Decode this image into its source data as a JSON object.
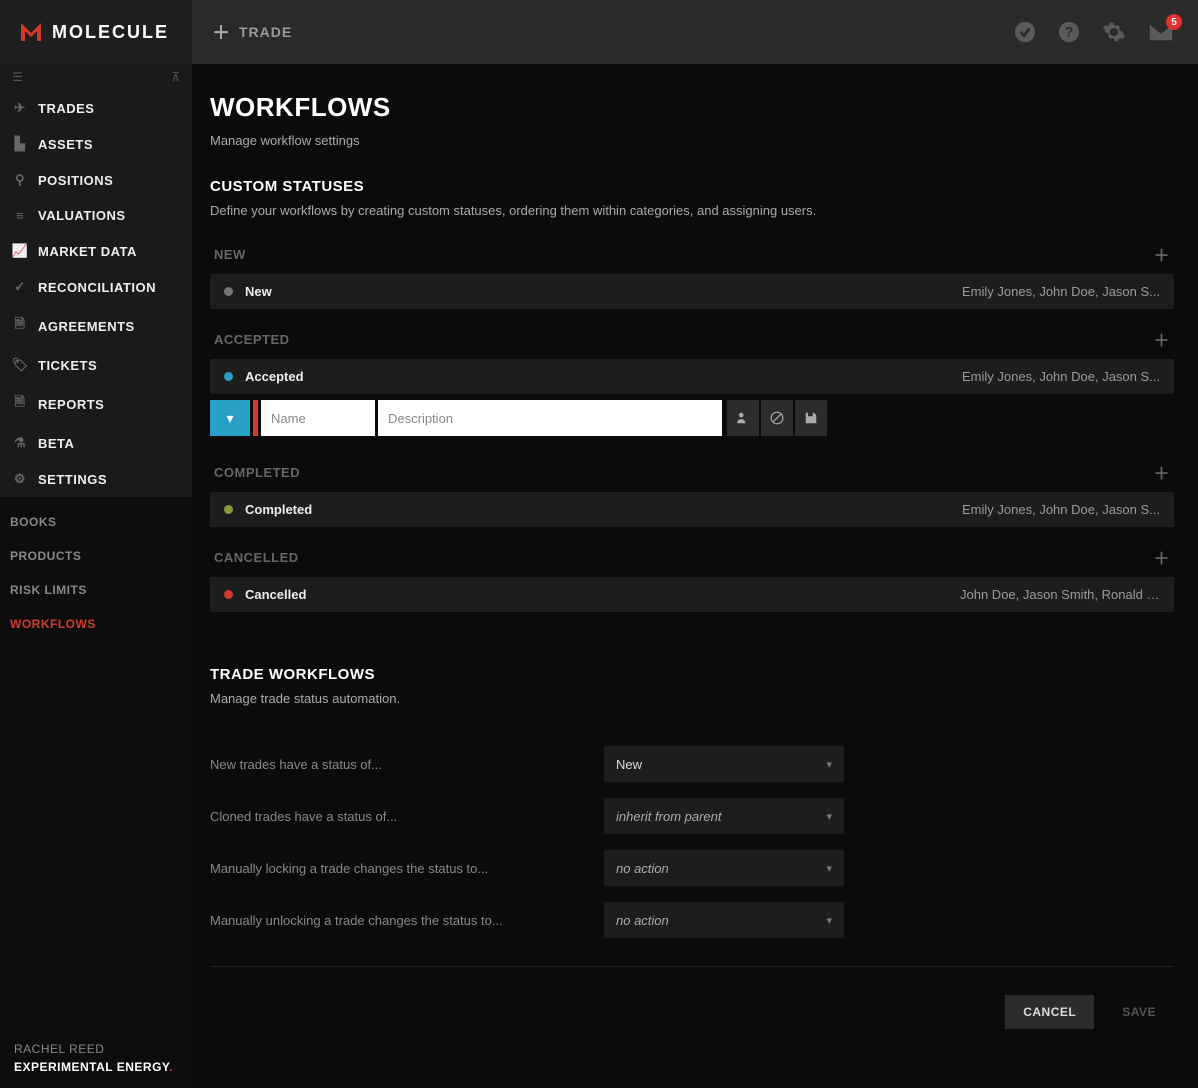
{
  "brand": "MOLECULE",
  "topbar": {
    "action": "TRADE",
    "notification_count": "5"
  },
  "sidebar": {
    "items": [
      {
        "label": "TRADES"
      },
      {
        "label": "ASSETS"
      },
      {
        "label": "POSITIONS"
      },
      {
        "label": "VALUATIONS"
      },
      {
        "label": "MARKET DATA"
      },
      {
        "label": "RECONCILIATION"
      },
      {
        "label": "AGREEMENTS"
      },
      {
        "label": "TICKETS"
      },
      {
        "label": "REPORTS"
      },
      {
        "label": "BETA"
      },
      {
        "label": "SETTINGS"
      }
    ],
    "sub_items": [
      {
        "label": "BOOKS"
      },
      {
        "label": "PRODUCTS"
      },
      {
        "label": "RISK LIMITS"
      },
      {
        "label": "WORKFLOWS"
      }
    ],
    "user": "RACHEL REED",
    "org": "EXPERIMENTAL ENERGY"
  },
  "page": {
    "title": "WORKFLOWS",
    "subtitle": "Manage workflow settings"
  },
  "custom_statuses": {
    "title": "CUSTOM STATUSES",
    "desc": "Define your workflows by creating custom statuses, ordering them within categories, and assigning users.",
    "categories": [
      {
        "name": "NEW",
        "statuses": [
          {
            "name": "New",
            "color": "#777",
            "users": "Emily Jones, John Doe, Jason S..."
          }
        ]
      },
      {
        "name": "ACCEPTED",
        "statuses": [
          {
            "name": "Accepted",
            "color": "#2aa0c8",
            "users": "Emily Jones, John Doe, Jason S..."
          }
        ],
        "editor": {
          "name_placeholder": "Name",
          "desc_placeholder": "Description"
        }
      },
      {
        "name": "COMPLETED",
        "statuses": [
          {
            "name": "Completed",
            "color": "#8a9a3a",
            "users": "Emily Jones, John Doe, Jason S..."
          }
        ]
      },
      {
        "name": "CANCELLED",
        "statuses": [
          {
            "name": "Cancelled",
            "color": "#d43a2a",
            "users": "John Doe, Jason Smith, Ronald J..."
          }
        ]
      }
    ]
  },
  "trade_workflows": {
    "title": "TRADE WORKFLOWS",
    "desc": "Manage trade status automation.",
    "rows": [
      {
        "label": "New trades have a status of...",
        "value": "New",
        "italic": false
      },
      {
        "label": "Cloned trades have a status of...",
        "value": "inherit from parent",
        "italic": true
      },
      {
        "label": "Manually locking a trade changes the status to...",
        "value": "no action",
        "italic": true
      },
      {
        "label": "Manually unlocking a trade changes the status to...",
        "value": "no action",
        "italic": true
      }
    ]
  },
  "actions": {
    "cancel": "CANCEL",
    "save": "SAVE"
  }
}
